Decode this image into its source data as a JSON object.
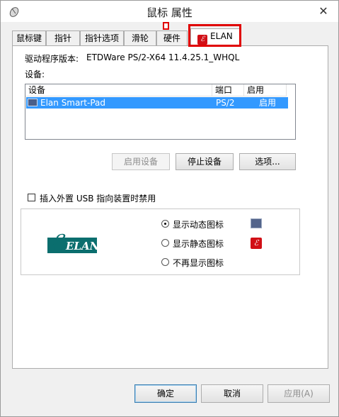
{
  "window": {
    "title": "鼠标 属性",
    "close_glyph": "✕"
  },
  "tabs": [
    {
      "label": "鼠标键"
    },
    {
      "label": "指针"
    },
    {
      "label": "指针选项"
    },
    {
      "label": "滑轮"
    },
    {
      "label": "硬件"
    },
    {
      "label": "ELAN",
      "active": true
    }
  ],
  "elan": {
    "driver_version_label": "驱动程序版本:",
    "driver_version_value": "ETDWare PS/2-X64 11.4.25.1_WHQL",
    "devices_label": "设备:",
    "list_headers": {
      "device": "设备",
      "port": "端口",
      "enabled": "启用"
    },
    "devices": [
      {
        "name": "Elan Smart-Pad",
        "port": "PS/2",
        "enabled": "启用",
        "selected": true
      }
    ],
    "buttons": {
      "enable": "启用设备",
      "stop": "停止设备",
      "options": "选项..."
    },
    "usb_checkbox_label": "插入外置 USB 指向装置时禁用",
    "usb_checkbox_checked": false,
    "icon_options": [
      {
        "label": "显示动态图标",
        "selected": true,
        "icon": "monitor-icon"
      },
      {
        "label": "显示静态图标",
        "selected": false,
        "icon": "elan-icon"
      },
      {
        "label": "不再显示图标",
        "selected": false,
        "icon": ""
      }
    ],
    "logo_text": "ELAN"
  },
  "footer": {
    "ok": "确定",
    "cancel": "取消",
    "apply": "应用(A)"
  },
  "colors": {
    "highlight_red": "#e00000",
    "selection_blue": "#3399ff",
    "elan_teal": "#0b6e6e",
    "elan_red": "#d10f16"
  }
}
